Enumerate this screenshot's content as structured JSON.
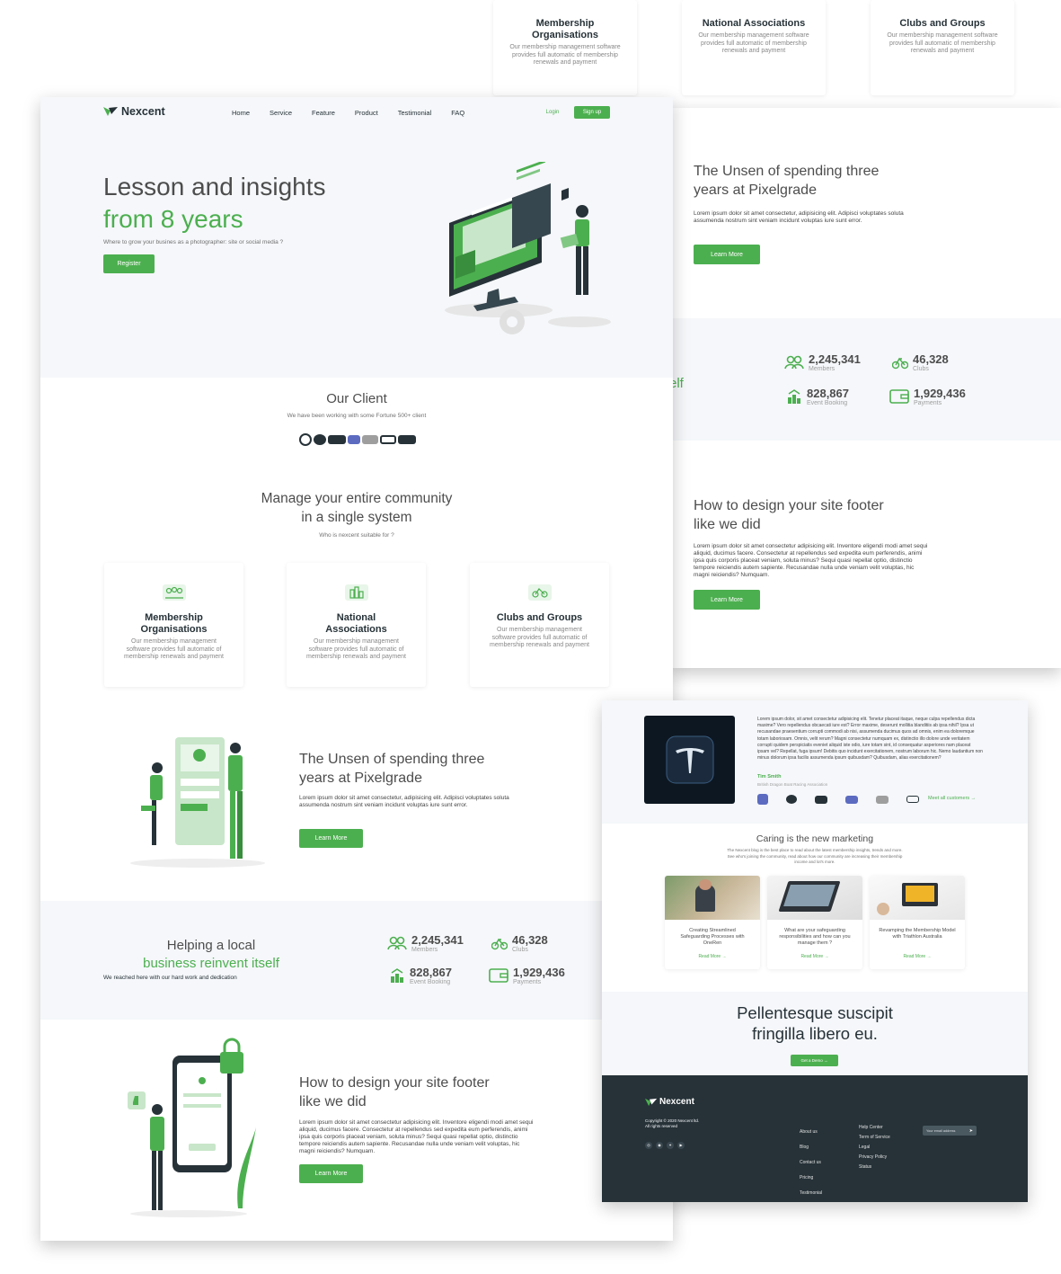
{
  "top_cards": [
    {
      "title": "Membership Organisations",
      "desc": "Our membership management software provides full automatic of membership renewals and payment"
    },
    {
      "title": "National Associations",
      "desc": "Our membership management software provides full automatic of membership renewals and payment"
    },
    {
      "title": "Clubs and Groups",
      "desc": "Our membership management software provides full automatic of membership renewals and payment"
    }
  ],
  "nav": {
    "logo": "Nexcent",
    "links": [
      "Home",
      "Service",
      "Feature",
      "Product",
      "Testimonial",
      "FAQ"
    ],
    "login": "Login",
    "signup": "Sign up"
  },
  "hero": {
    "title_line1": "Lesson and insights",
    "title_line2": "from 8 years",
    "subtitle": "Where to grow your busines as a photographer: site or social media ?",
    "register": "Register"
  },
  "client": {
    "title": "Our Client",
    "subtitle": "We have been working with some Fortune 500+ client"
  },
  "community": {
    "title_line1": "Manage your entire community",
    "title_line2": "in a single system",
    "subtitle": "Who is nexcent suitable for ?",
    "cards": [
      {
        "title": "Membership Organisations",
        "desc": "Our membership management software provides full automatic of membership renewals and payment"
      },
      {
        "title": "National Associations",
        "desc": "Our membership management software provides full automatic of membership renewals and payment"
      },
      {
        "title": "Clubs and Groups",
        "desc": "Our membership management software provides full automatic of membership renewals and payment"
      }
    ]
  },
  "unseen": {
    "title_line1": "The Unsen of spending three",
    "title_line2": "years at Pixelgrade",
    "text": "Lorem ipsum dolor sit amet consectetur, adipisicing elit. Adipisci voluptates soluta assumenda nostrum sint veniam incidunt voluptas iure sunt error.",
    "button": "Learn More"
  },
  "helping": {
    "title_line1": "Helping a local",
    "title_line2": "business reinvent itself",
    "subtitle": "We reached here with our hard work and dedication",
    "right_fragment": "elf"
  },
  "stats": [
    {
      "value": "2,245,341",
      "label": "Members"
    },
    {
      "value": "46,328",
      "label": "Clubs"
    },
    {
      "value": "828,867",
      "label": "Event Booking"
    },
    {
      "value": "1,929,436",
      "label": "Payments"
    }
  ],
  "footer_design": {
    "title_line1": "How to design your site footer",
    "title_line2": "like we did",
    "text": "Lorem ipsum dolor sit amet consectetur adipisicing elit. Inventore eligendi modi amet sequi aliquid, ducimus facere. Consectetur at repellendus sed expedita eum perferendis, animi ipsa quis corporis placeat veniam, soluta minus? Sequi quasi repellat optio, distinctio tempore reiciendis autem sapiente. Recusandae nulla unde veniam velit voluptas, hic magni reiciendis? Numquam.",
    "button": "Learn More"
  },
  "testimonial": {
    "text": "Lorem ipsum dolor, sit amet consectetur adipisicing elit. Tenetur placeat itaque, neque culpa repellendus dicta maxime? Vero repellendus obcaecati iure est? Error maxime, deserunt mollitia blanditiis ab ipsa nihil? Ipsa ut recusandae praesentium corrupti commodi ab nisi, assumenda ducimus quos ad omnis, enim ea doloremque totam laboriosam. Omnis, velit rerum? Magni consectetur numquam ex, distinctio illo dolore unde veritatem corrupti quidem perspiciatis eveniet aliquid iste odio, iure totam sint, id consequatur asperiores nam placeat ipsam vel? Repellat, fuga ipsum! Debitis quo incidunt exercitationem, nostrum laborum hic. Nemo laudantium non minus dolorum ipsa facilis assumenda ipsum quibusdam? Quibusdam, alias exercitationem?",
    "name": "Tim Smith",
    "role": "British Dragon Boat Racing Association",
    "meet_link": "Meet all customers →"
  },
  "marketing": {
    "title": "Caring is the new marketing",
    "subtitle": "The Nexcent blog is the best place to read about the latest membership insights, trends and more. See who's joining the community, read about how our community are increasing their membership income and lot's more.",
    "posts": [
      {
        "title": "Creating Streamlined Safeguarding Processes with OneRen",
        "link": "Read More →"
      },
      {
        "title": "What are your safeguarding responsibilities and how can you manage them ?",
        "link": "Read More →"
      },
      {
        "title": "Revamping the Membership Model with Triathlon Australia",
        "link": "Read More →"
      }
    ]
  },
  "cta": {
    "title_line1": "Pellentesque suscipit",
    "title_line2": "fringilla libero eu.",
    "button": "Get a Demo →"
  },
  "footer": {
    "logo": "Nexcent",
    "copyright": "Copyright © 2020 Nexcent ltd.",
    "rights": "All rights reserved",
    "col1": [
      "About us",
      "Blog",
      "Contact us",
      "Pricing",
      "Testimonial"
    ],
    "col2": [
      "Help Center",
      "Term of Service",
      "Legal",
      "Privacy Policy",
      "Status"
    ],
    "email_placeholder": "Your email address"
  },
  "colors": {
    "primary": "#4caf4f",
    "dark": "#263238",
    "light_bg": "#f5f7fa"
  }
}
